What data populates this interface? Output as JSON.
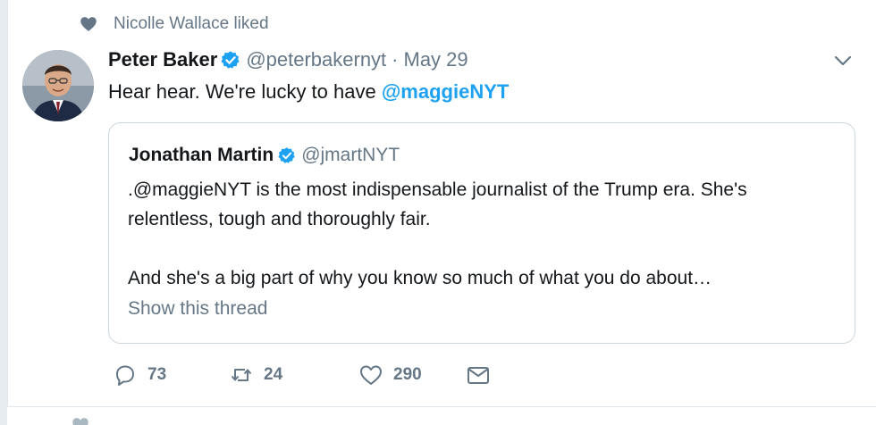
{
  "social_context": {
    "text": "Nicolle Wallace liked",
    "icon": "heart-icon"
  },
  "tweet": {
    "author_name": "Peter Baker",
    "author_handle": "@peterbakernyt",
    "separator": "·",
    "date": "May 29",
    "text_prefix": "Hear hear. We're lucky to have ",
    "mention": "@maggieNYT",
    "verified": true
  },
  "quoted_tweet": {
    "author_name": "Jonathan Martin",
    "author_handle": "@jmartNYT",
    "verified": true,
    "lines": [
      ".@maggieNYT  is the most indispensable journalist of the Trump era.  She's",
      "relentless, tough and thoroughly fair.",
      "And she's a big part of why you know so much of what you do about…"
    ],
    "show_thread": "Show this thread"
  },
  "actions": {
    "replies": "73",
    "retweets": "24",
    "likes": "290"
  },
  "colors": {
    "link_blue": "#1da1f2",
    "secondary_gray": "#657786",
    "border": "#ccd6dd"
  }
}
